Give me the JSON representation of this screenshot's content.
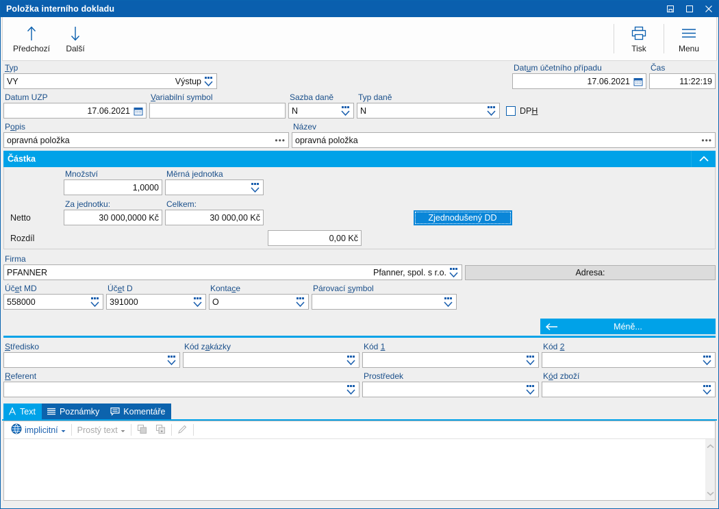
{
  "window": {
    "title": "Položka interního dokladu",
    "controls": [
      "restore-icon",
      "maximize-icon",
      "close-icon"
    ]
  },
  "toolbar": {
    "prev_label": "Předchozí",
    "next_label": "Další",
    "print_label": "Tisk",
    "menu_label": "Menu",
    "prev_icon": "arrow-up-icon",
    "next_icon": "arrow-down-icon",
    "print_icon": "printer-icon",
    "menu_icon": "hamburger-icon"
  },
  "form": {
    "typ": {
      "label": "Typ",
      "label_mnemonic": "T",
      "value": "VY",
      "secondary": "Výstup"
    },
    "datum_uzp": {
      "label": "Datum UZP",
      "value": "17.06.2021"
    },
    "variabilni_symbol": {
      "label": "Variabilní symbol",
      "label_mnemonic": "V",
      "value": ""
    },
    "sazba_dane": {
      "label": "Sazba daně",
      "value": "N"
    },
    "typ_dane": {
      "label": "Typ daně",
      "value": "N"
    },
    "dph": {
      "label": "DPH",
      "checked": false
    },
    "datum_uc_pripadu": {
      "label": "Datum účetního případu",
      "value": "17.06.2021"
    },
    "cas": {
      "label": "Čas",
      "value": "11:22:19"
    },
    "popis": {
      "label": "Popis",
      "value": "opravná položka"
    },
    "nazev": {
      "label": "Název",
      "value": "opravná položka"
    }
  },
  "castka": {
    "section_title": "Částka",
    "mnozstvi": {
      "label": "Množství",
      "value": "1,0000"
    },
    "merna_jednotka": {
      "label": "Měrná jednotka",
      "value": ""
    },
    "za_jednotku_label": "Za jednotku:",
    "celkem_label": "Celkem:",
    "netto_label": "Netto",
    "netto_za_jednotku": "30 000,0000 Kč",
    "netto_celkem": "30 000,00 Kč",
    "rozdil_label": "Rozdíl",
    "rozdil_value": "0,00 Kč",
    "zjednoduseny_dd": "Zjednodušený DD"
  },
  "firma": {
    "label": "Firma",
    "value": "PFANNER",
    "secondary": "Pfanner, spol. s r.o.",
    "adresa_button": "Adresa:"
  },
  "ucetnictvi": {
    "ucet_md": {
      "label": "Účet MD",
      "value": "558000"
    },
    "ucet_d": {
      "label": "Účet D",
      "value": "391000"
    },
    "kontace": {
      "label": "Kontace",
      "value": "O"
    },
    "parovaci_symbol": {
      "label": "Párovací symbol",
      "value": ""
    },
    "mene_button": "Méně..."
  },
  "kody": {
    "stredisko": {
      "label": "Středisko",
      "value": ""
    },
    "kod_zakazky": {
      "label": "Kód zakázky",
      "value": ""
    },
    "kod_1": {
      "label": "Kód 1",
      "value": ""
    },
    "kod_2": {
      "label": "Kód 2",
      "value": ""
    },
    "referent": {
      "label": "Referent",
      "value": ""
    },
    "prostredek": {
      "label": "Prostředek",
      "value": ""
    },
    "kod_zbozi": {
      "label": "Kód zboží",
      "value": ""
    }
  },
  "tabs": [
    {
      "label": "Text",
      "icon": "letter-a-icon",
      "active": true
    },
    {
      "label": "Poznámky",
      "icon": "lines-icon",
      "active": false
    },
    {
      "label": "Komentáře",
      "icon": "comment-icon",
      "active": false
    }
  ],
  "editor": {
    "language": "implicitní",
    "format": "Prostý text",
    "globe_icon": "globe-icon",
    "copy_icon": "copy-icon",
    "copy_add_icon": "copy-add-icon",
    "edit_icon": "pencil-icon",
    "content": ""
  },
  "colors": {
    "title_bar": "#0a5fae",
    "accent_cyan": "#00a2e8",
    "tab_inactive": "#0c63ad",
    "label_blue": "#1a4f8a",
    "focus_button": "#0a86d8"
  }
}
